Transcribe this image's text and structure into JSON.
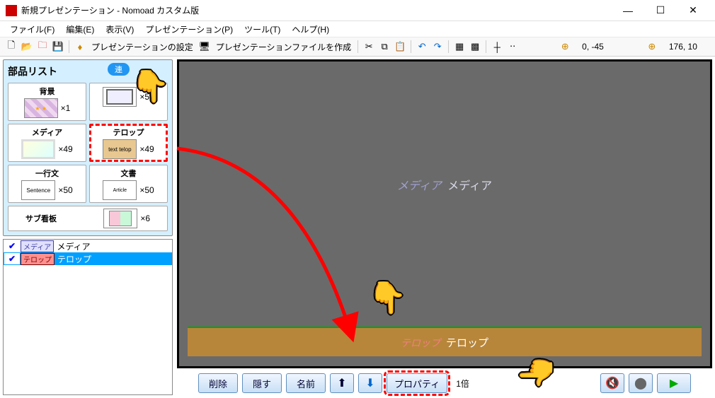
{
  "window": {
    "title": "新規プレゼンテーション - Nomoad カスタム版"
  },
  "menu": {
    "file": "ファイル(F)",
    "edit": "編集(E)",
    "view": "表示(V)",
    "presentation": "プレゼンテーション(P)",
    "tool": "ツール(T)",
    "help": "ヘルプ(H)"
  },
  "toolbar": {
    "settings_label": "プレゼンテーションの設定",
    "createfile_label": "プレゼンテーションファイルを作成",
    "coord1": "0, -45",
    "coord2": "176, 10"
  },
  "parts": {
    "title": "部品リスト",
    "toggle": "連",
    "items": [
      {
        "label": "背景",
        "count": "×1",
        "thumb": "bg"
      },
      {
        "label": "",
        "count": "×50",
        "thumb": "frame"
      },
      {
        "label": "メディア",
        "count": "×49",
        "thumb": "media"
      },
      {
        "label": "テロップ",
        "count": "×49",
        "thumb": "telop",
        "thumb_text": "text telop",
        "highlighted": true
      },
      {
        "label": "一行文",
        "count": "×50",
        "thumb": "sentence",
        "thumb_text": "Sentence"
      },
      {
        "label": "文書",
        "count": "×50",
        "thumb": "article",
        "thumb_text": "Article"
      }
    ],
    "sub_label": "サブ看板",
    "sub_count": "×6"
  },
  "layers": [
    {
      "tag": "メディア",
      "tag_class": "media",
      "name": "メディア",
      "selected": false
    },
    {
      "tag": "テロップ",
      "tag_class": "telop",
      "name": "テロップ",
      "selected": true
    }
  ],
  "canvas": {
    "media_en": "メディア",
    "media_jp": "メディア",
    "telop_en": "テロップ",
    "telop_jp": "テロップ"
  },
  "bottom": {
    "delete": "削除",
    "hide": "隠す",
    "name": "名前",
    "property": "プロパティ",
    "zoom": "1倍"
  }
}
